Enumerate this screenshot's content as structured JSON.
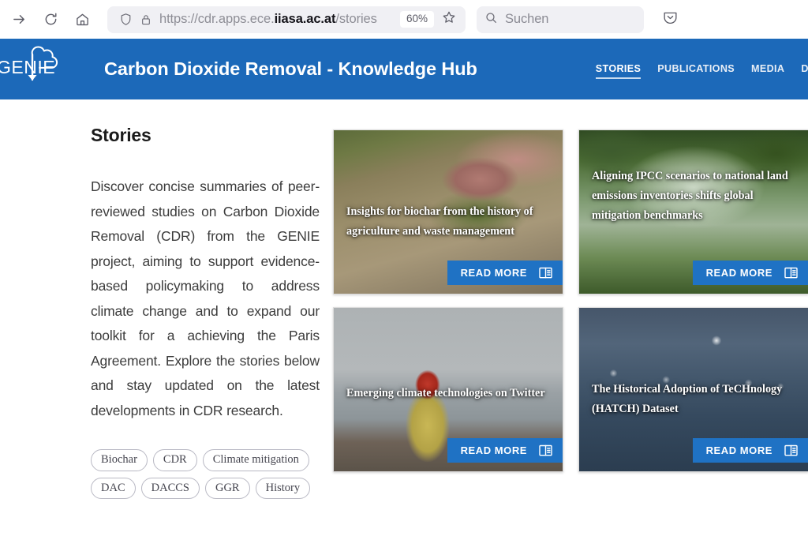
{
  "browser": {
    "toolbar_icons": [
      "forward-arrow-icon",
      "reload-icon",
      "home-icon"
    ],
    "url": {
      "shield_icon": "shield-icon",
      "lock_icon": "lock-icon",
      "scheme": "https://cdr.apps.ece.",
      "host": "iiasa.ac.at",
      "path": "/stories",
      "full": "https://cdr.apps.ece.iiasa.ac.at/stories"
    },
    "zoom_level": "60%",
    "bookmark_icon": "star-icon",
    "search": {
      "icon": "search-icon",
      "placeholder": "Suchen",
      "value": ""
    },
    "overflow_icon": "chevron-down-pocket-icon"
  },
  "site_header": {
    "logo_text": "GENIE",
    "logo_icon": "cloud-download-icon",
    "title": "Carbon Dioxide Removal - Knowledge Hub",
    "nav": [
      {
        "label": "STORIES",
        "active": true
      },
      {
        "label": "PUBLICATIONS",
        "active": false
      },
      {
        "label": "MEDIA",
        "active": false
      },
      {
        "label": "DATA E",
        "active": false
      }
    ],
    "brand_color": "#1c69b9"
  },
  "main": {
    "page_title": "Stories",
    "intro": "Discover concise summaries of peer-reviewed studies on Carbon Dioxide Removal (CDR) from the GENIE project, aiming to support evidence-based policymaking to address climate change and to expand our toolkit for a achieving the Paris Agreement. Explore the stories below and stay updated on the latest developments in CDR research.",
    "tags": [
      "Biochar",
      "CDR",
      "Climate mitigation",
      "DAC",
      "DACCS",
      "GGR",
      "History"
    ],
    "read_more_label": "READ MORE",
    "read_more_icon": "article-layout-icon",
    "accent_color": "#1f72c4",
    "cards": [
      {
        "title": "Insights for biochar from the history of agriculture and waste management",
        "image": "person planting seedling in biochar soil"
      },
      {
        "title": "Aligning IPCC scenarios to national land emissions inventories shifts global mitigation benchmarks",
        "image": "misty green forest canopy"
      },
      {
        "title": "Emerging climate technologies on Twitter",
        "image": "person in red hat and yellow raincoat by grey water"
      },
      {
        "title": "The Historical Adoption of TeCHnology (HATCH) Dataset",
        "image": "city skyline at dusk with network nodes"
      }
    ]
  }
}
